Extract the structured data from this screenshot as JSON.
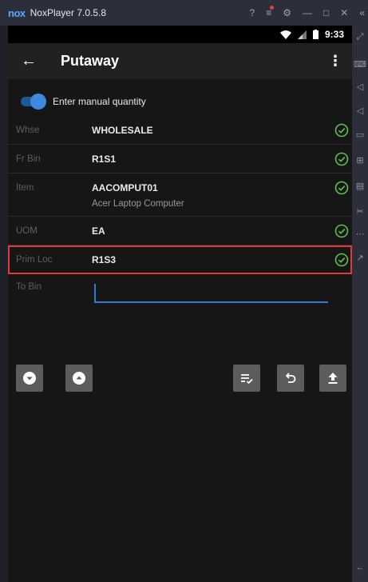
{
  "emulator": {
    "logo": "nox",
    "title": "NoxPlayer 7.0.5.8",
    "controls": [
      "?",
      "≡",
      "⚙",
      "—",
      "□",
      "✕",
      "«"
    ]
  },
  "status_bar": {
    "time": "9:33",
    "icons": [
      "wifi-icon",
      "signal-icon",
      "battery-icon"
    ]
  },
  "app_bar": {
    "title": "Putaway",
    "back_icon": "arrow-left-icon",
    "menu_icon": "more-vertical-icon"
  },
  "manual_quantity": {
    "label": "Enter manual quantity",
    "enabled": true
  },
  "fields": {
    "whse": {
      "label": "Whse",
      "value": "WHOLESALE",
      "valid": true
    },
    "fr_bin": {
      "label": "Fr Bin",
      "value": "R1S1",
      "valid": true
    },
    "item": {
      "label": "Item",
      "value": "AACOMPUT01",
      "description": "Acer Laptop Computer",
      "valid": true
    },
    "uom": {
      "label": "UOM",
      "value": "EA",
      "valid": true
    },
    "prim_loc": {
      "label": "Prim Loc",
      "value": "R1S3",
      "valid": true
    }
  },
  "to_bin": {
    "label": "To Bin",
    "value": "",
    "placeholder": ""
  },
  "actions": [
    "scroll-down-button",
    "scroll-up-button",
    "list-check-button",
    "undo-button",
    "upload-button"
  ],
  "colors": {
    "accent": "#2e7bd1",
    "check": "#5cc04b",
    "highlight": "#e03b3b"
  }
}
